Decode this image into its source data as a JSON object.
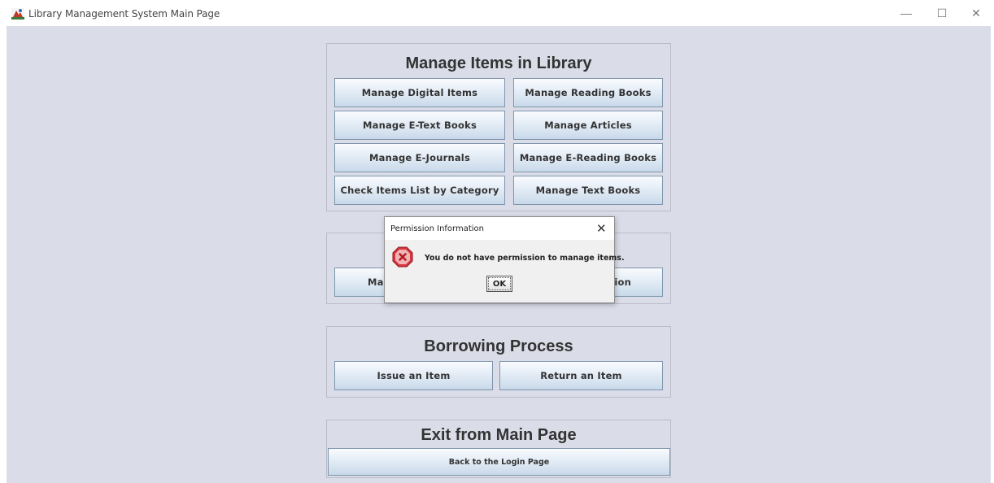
{
  "window": {
    "title": "Library Management System Main Page",
    "minimize": "—",
    "maximize": "☐",
    "close": "✕"
  },
  "manage_items": {
    "title": "Manage Items in Library",
    "buttons": [
      "Manage Digital Items",
      "Manage Reading Books",
      "Manage E-Text Books",
      "Manage Articles",
      "Manage E-Journals",
      "Manage E-Reading Books",
      "Check Items List by Category",
      "Manage Text Books"
    ]
  },
  "obscured_panel": {
    "left_button_fragment": "Mar",
    "right_button_fragment": "tion"
  },
  "borrowing": {
    "title": "Borrowing Process",
    "issue": "Issue an Item",
    "return": "Return an Item"
  },
  "exit": {
    "title": "Exit from Main Page",
    "back": "Back to the Login Page"
  },
  "dialog": {
    "title": "Permission Information",
    "close": "✕",
    "message": "You do not have permission to manage items.",
    "ok": "OK",
    "icon": "error-icon"
  },
  "colors": {
    "background": "#dadde8",
    "button_border": "#7e95ad",
    "error_red": "#d9363e"
  }
}
